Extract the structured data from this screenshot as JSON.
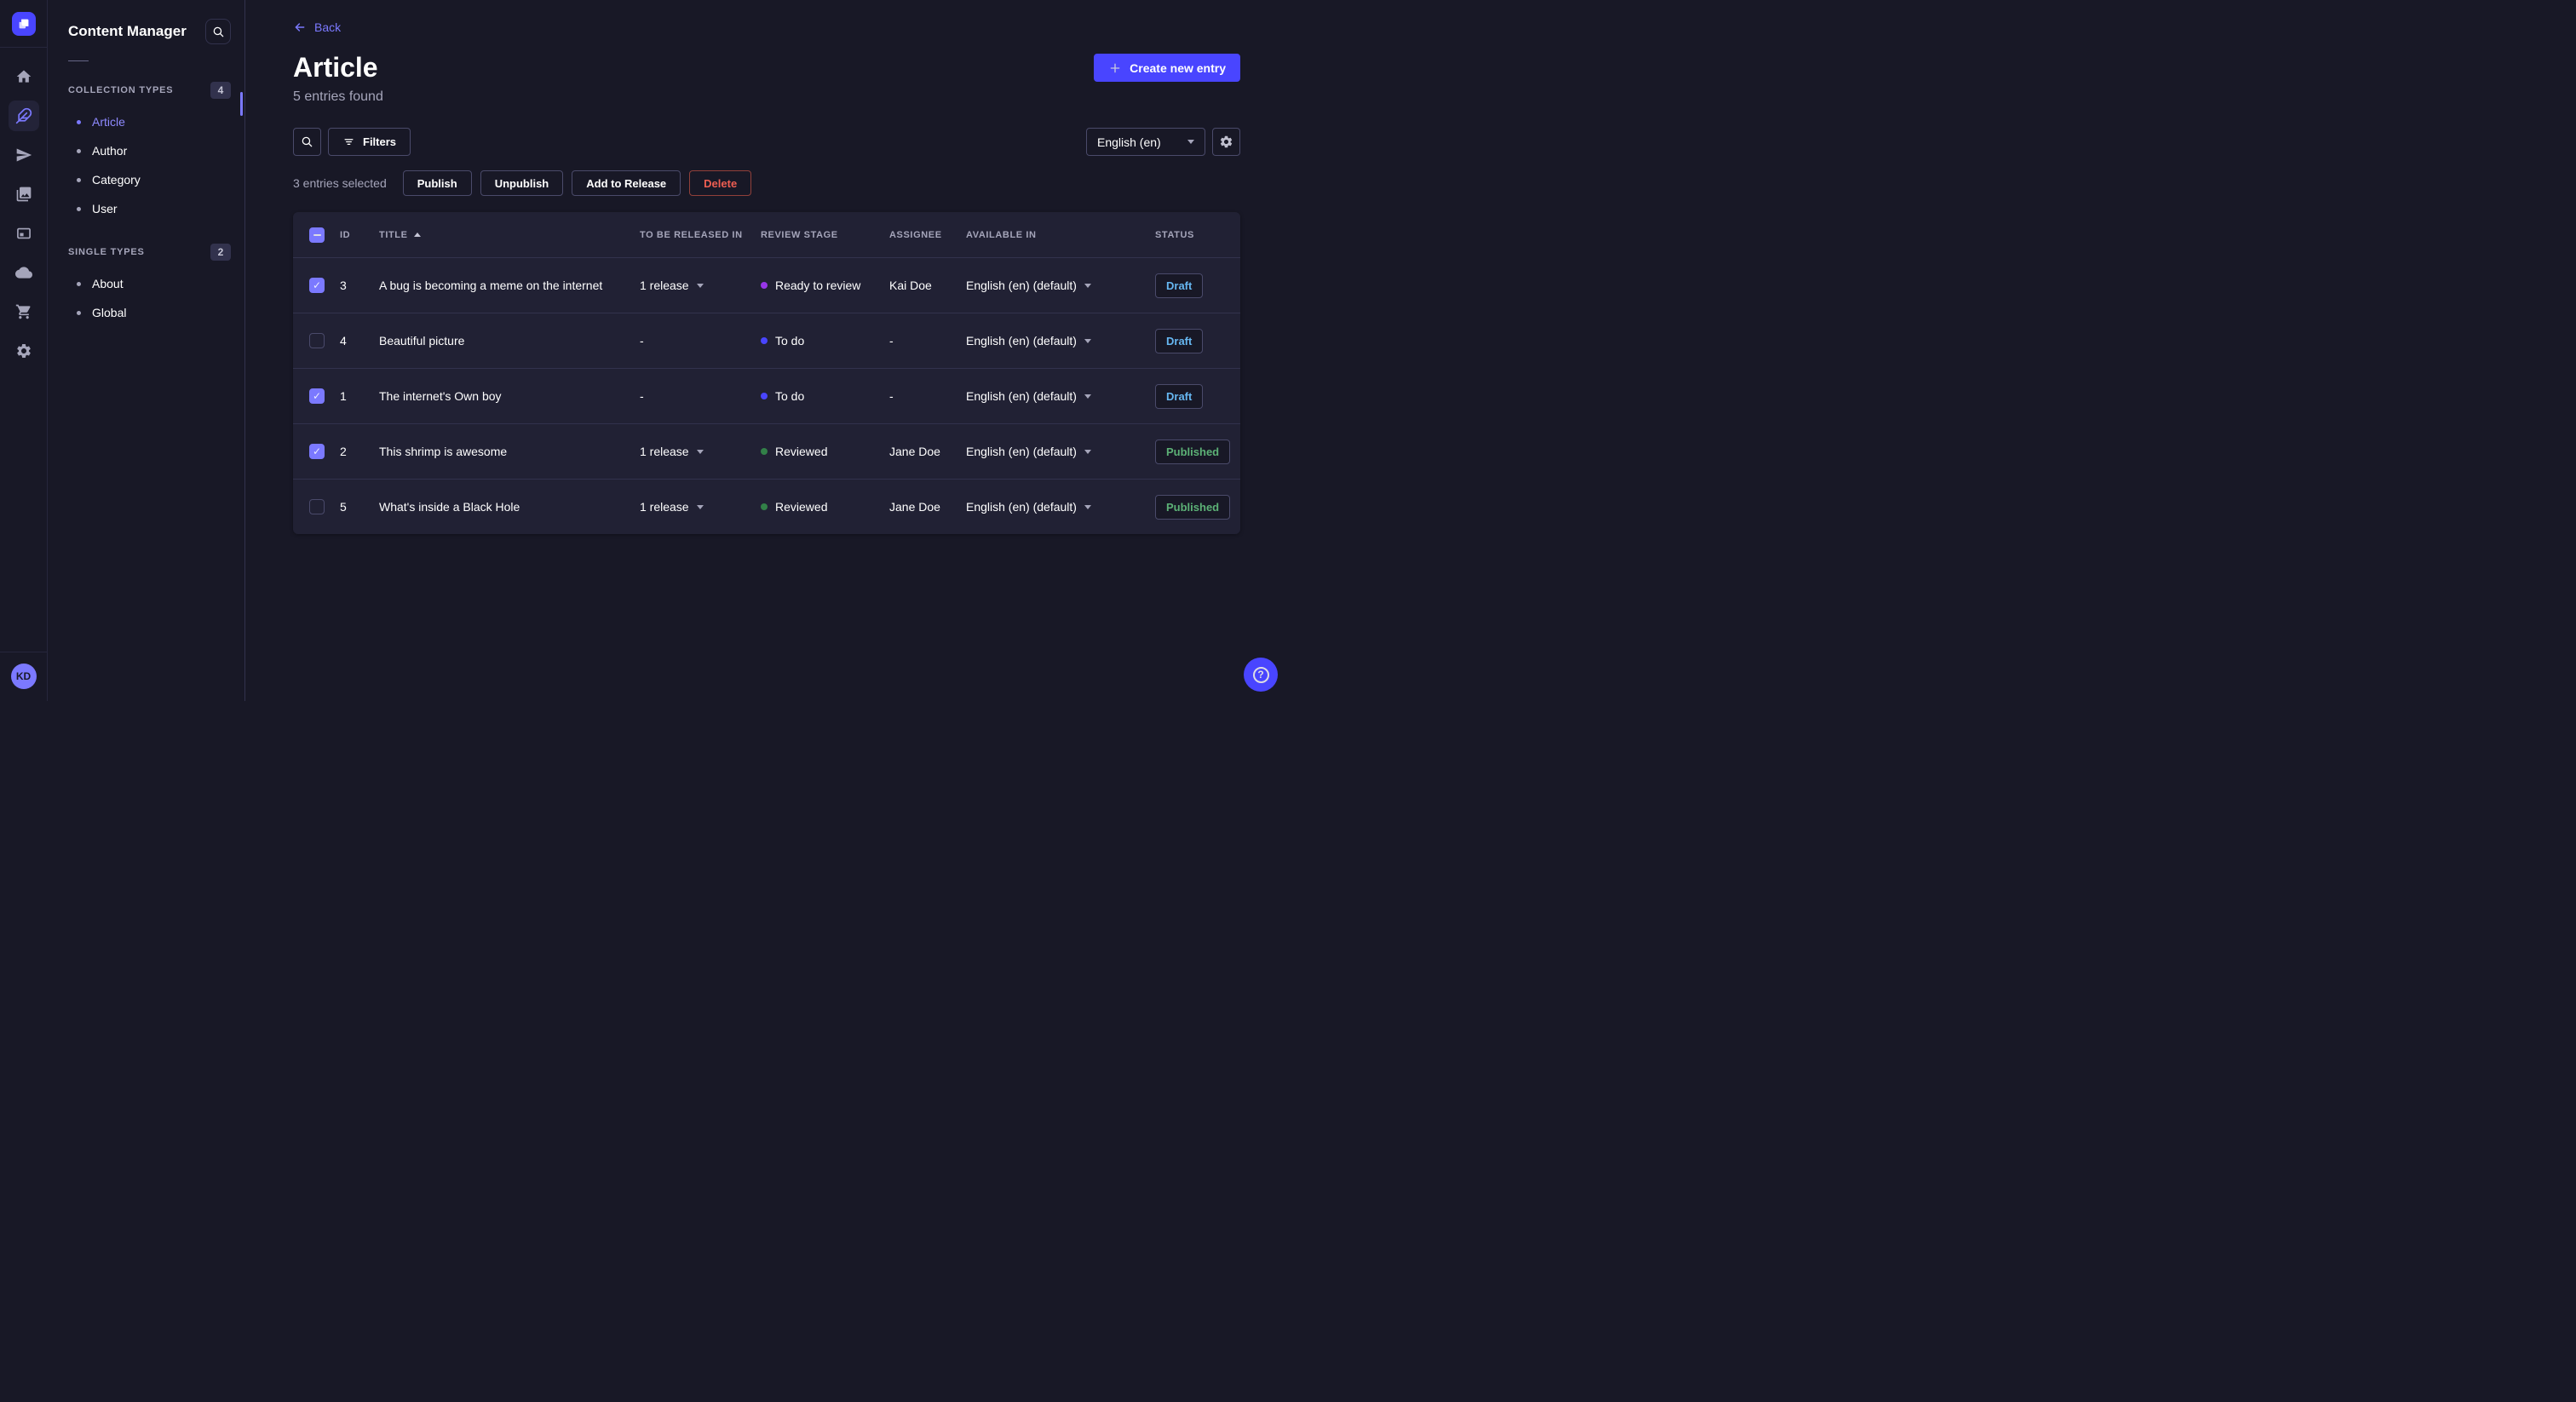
{
  "colors": {
    "accent": "#4945ff",
    "accent_light": "#7b79ff",
    "draft": "#66b7f1",
    "published": "#5cb176",
    "danger": "#ee5e52"
  },
  "rail": {
    "items": [
      {
        "name": "home",
        "active": "false"
      },
      {
        "name": "content-manager",
        "active": "true"
      },
      {
        "name": "releases",
        "active": "false"
      },
      {
        "name": "media-library",
        "active": "false"
      },
      {
        "name": "content-type-builder",
        "active": "false"
      },
      {
        "name": "deploy-cloud",
        "active": "false"
      },
      {
        "name": "marketplace",
        "active": "false"
      },
      {
        "name": "settings",
        "active": "false"
      }
    ],
    "avatar_initials": "KD"
  },
  "subnav": {
    "title": "Content Manager",
    "sections": [
      {
        "label": "COLLECTION TYPES",
        "count": "4",
        "items": [
          {
            "label": "Article",
            "active": "true"
          },
          {
            "label": "Author",
            "active": "false"
          },
          {
            "label": "Category",
            "active": "false"
          },
          {
            "label": "User",
            "active": "false"
          }
        ]
      },
      {
        "label": "SINGLE TYPES",
        "count": "2",
        "items": [
          {
            "label": "About",
            "active": "false"
          },
          {
            "label": "Global",
            "active": "false"
          }
        ]
      }
    ]
  },
  "header": {
    "back_label": "Back",
    "title": "Article",
    "subtitle": "5 entries found",
    "create_label": "Create new entry"
  },
  "toolbar": {
    "filters_label": "Filters",
    "locale_value": "English (en)"
  },
  "selection": {
    "summary": "3 entries selected",
    "publish": "Publish",
    "unpublish": "Unpublish",
    "add_to_release": "Add to Release",
    "delete": "Delete"
  },
  "table": {
    "select_all_state": "mixed",
    "sort": {
      "column": "TITLE",
      "direction": "asc"
    },
    "columns": {
      "id": "ID",
      "title": "TITLE",
      "release": "TO BE RELEASED IN",
      "stage": "REVIEW STAGE",
      "assignee": "ASSIGNEE",
      "available": "AVAILABLE IN",
      "status": "STATUS"
    },
    "rows": [
      {
        "checked": "true",
        "id": "3",
        "title": "A bug is becoming a meme on the internet",
        "release": "1 release",
        "has_caret": "true",
        "stage": "Ready to review",
        "stage_color": "#9736e8",
        "assignee": "Kai Doe",
        "available": "English (en) (default)",
        "status": "Draft",
        "status_color": "#66b7f1"
      },
      {
        "checked": "false",
        "id": "4",
        "title": "Beautiful picture",
        "release": "-",
        "has_caret": "false",
        "stage": "To do",
        "stage_color": "#4945ff",
        "assignee": "-",
        "available": "English (en) (default)",
        "status": "Draft",
        "status_color": "#66b7f1"
      },
      {
        "checked": "true",
        "id": "1",
        "title": "The internet's Own boy",
        "release": "-",
        "has_caret": "false",
        "stage": "To do",
        "stage_color": "#4945ff",
        "assignee": "-",
        "available": "English (en) (default)",
        "status": "Draft",
        "status_color": "#66b7f1"
      },
      {
        "checked": "true",
        "id": "2",
        "title": "This shrimp is awesome",
        "release": "1 release",
        "has_caret": "true",
        "stage": "Reviewed",
        "stage_color": "#328048",
        "assignee": "Jane Doe",
        "available": "English (en) (default)",
        "status": "Published",
        "status_color": "#5cb176"
      },
      {
        "checked": "false",
        "id": "5",
        "title": "What's inside a Black Hole",
        "release": "1 release",
        "has_caret": "true",
        "stage": "Reviewed",
        "stage_color": "#328048",
        "assignee": "Jane Doe",
        "available": "English (en) (default)",
        "status": "Published",
        "status_color": "#5cb176"
      }
    ]
  }
}
